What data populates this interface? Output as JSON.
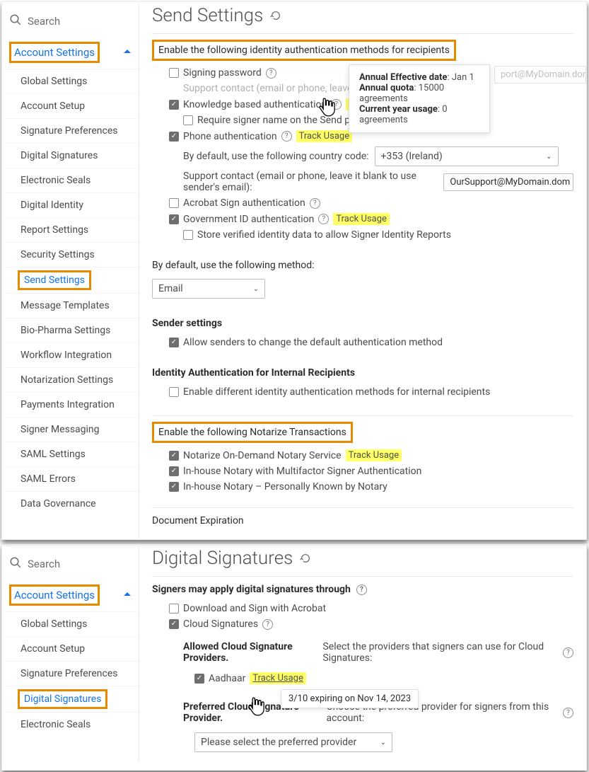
{
  "search": {
    "placeholder": "Search"
  },
  "sidebar_header": "Account Settings",
  "nav1": [
    "Global Settings",
    "Account Setup",
    "Signature Preferences",
    "Digital Signatures",
    "Electronic Seals",
    "Digital Identity",
    "Report Settings",
    "Security Settings",
    "Send Settings",
    "Message Templates",
    "Bio-Pharma Settings",
    "Workflow Integration",
    "Notarization Settings",
    "Payments Integration",
    "Signer Messaging",
    "SAML Settings",
    "SAML Errors",
    "Data Governance"
  ],
  "nav2": [
    "Global Settings",
    "Account Setup",
    "Signature Preferences",
    "Digital Signatures",
    "Electronic Seals"
  ],
  "sendSettings": {
    "title": "Send Settings",
    "authHeading": "Enable the following identity authentication methods for recipients",
    "signingPassword": "Signing password",
    "supportContactLbl": "Support contact (email or phone, leave it blank to us",
    "supportContactLbl2": "Support contact (email or phone, leave it blank to use sender's email):",
    "supportContactValGrey": "port@MyDomain.dom",
    "supportContactVal": "OurSupport@MyDomain.dom",
    "kba": "Knowledge based authentication",
    "requireSigner": "Require signer name on the Send page",
    "phoneAuth": "Phone authentication",
    "countryCodeLbl": "By default, use the following country code:",
    "countryCodeVal": "+353 (Ireland)",
    "acrobatSign": "Acrobat Sign authentication",
    "govId": "Government ID authentication",
    "storeId": "Store verified identity data to allow Signer Identity Reports",
    "defaultMethodLbl": "By default, use the following method:",
    "defaultMethodVal": "Email",
    "senderSettings": "Sender settings",
    "allowSenders": "Allow senders to change the default authentication method",
    "internalHeading": "Identity Authentication for Internal Recipients",
    "enableDiff": "Enable different identity authentication methods for internal recipients",
    "notarizeHeading": "Enable the following Notarize Transactions",
    "notarizeOnDemand": "Notarize On-Demand Notary Service",
    "inhouseMFA": "In-house Notary with Multifactor Signer Authentication",
    "inhousePK": "In-house Notary – Personally Known by Notary",
    "docExp": "Document Expiration",
    "track": "Track Usage",
    "tip": {
      "l1k": "Annual Effective date",
      "l1v": ": Jan 1",
      "l2k": "Annual quota",
      "l2v": ": 15000 agreements",
      "l3k": "Current year usage",
      "l3v": ": 0 agreements"
    }
  },
  "digitalSig": {
    "title": "Digital Signatures",
    "heading": "Signers may apply digital signatures through",
    "download": "Download and Sign with Acrobat",
    "cloud": "Cloud Signatures",
    "allowedHead": "Allowed Cloud Signature Providers.",
    "allowedBody": "Select the providers that signers can use for Cloud Signatures:",
    "aadhaar": "Aadhaar",
    "track": "Track Usage",
    "tooltip": {
      "count": "3/10",
      "text": " expiring on ",
      "date": "Nov 14, 2023"
    },
    "preferredHead": "Preferred Cloud Signature Provider.",
    "preferredBody": "Choose the preferred provider for signers from this account:",
    "providerSel": "Please select the preferred provider"
  }
}
